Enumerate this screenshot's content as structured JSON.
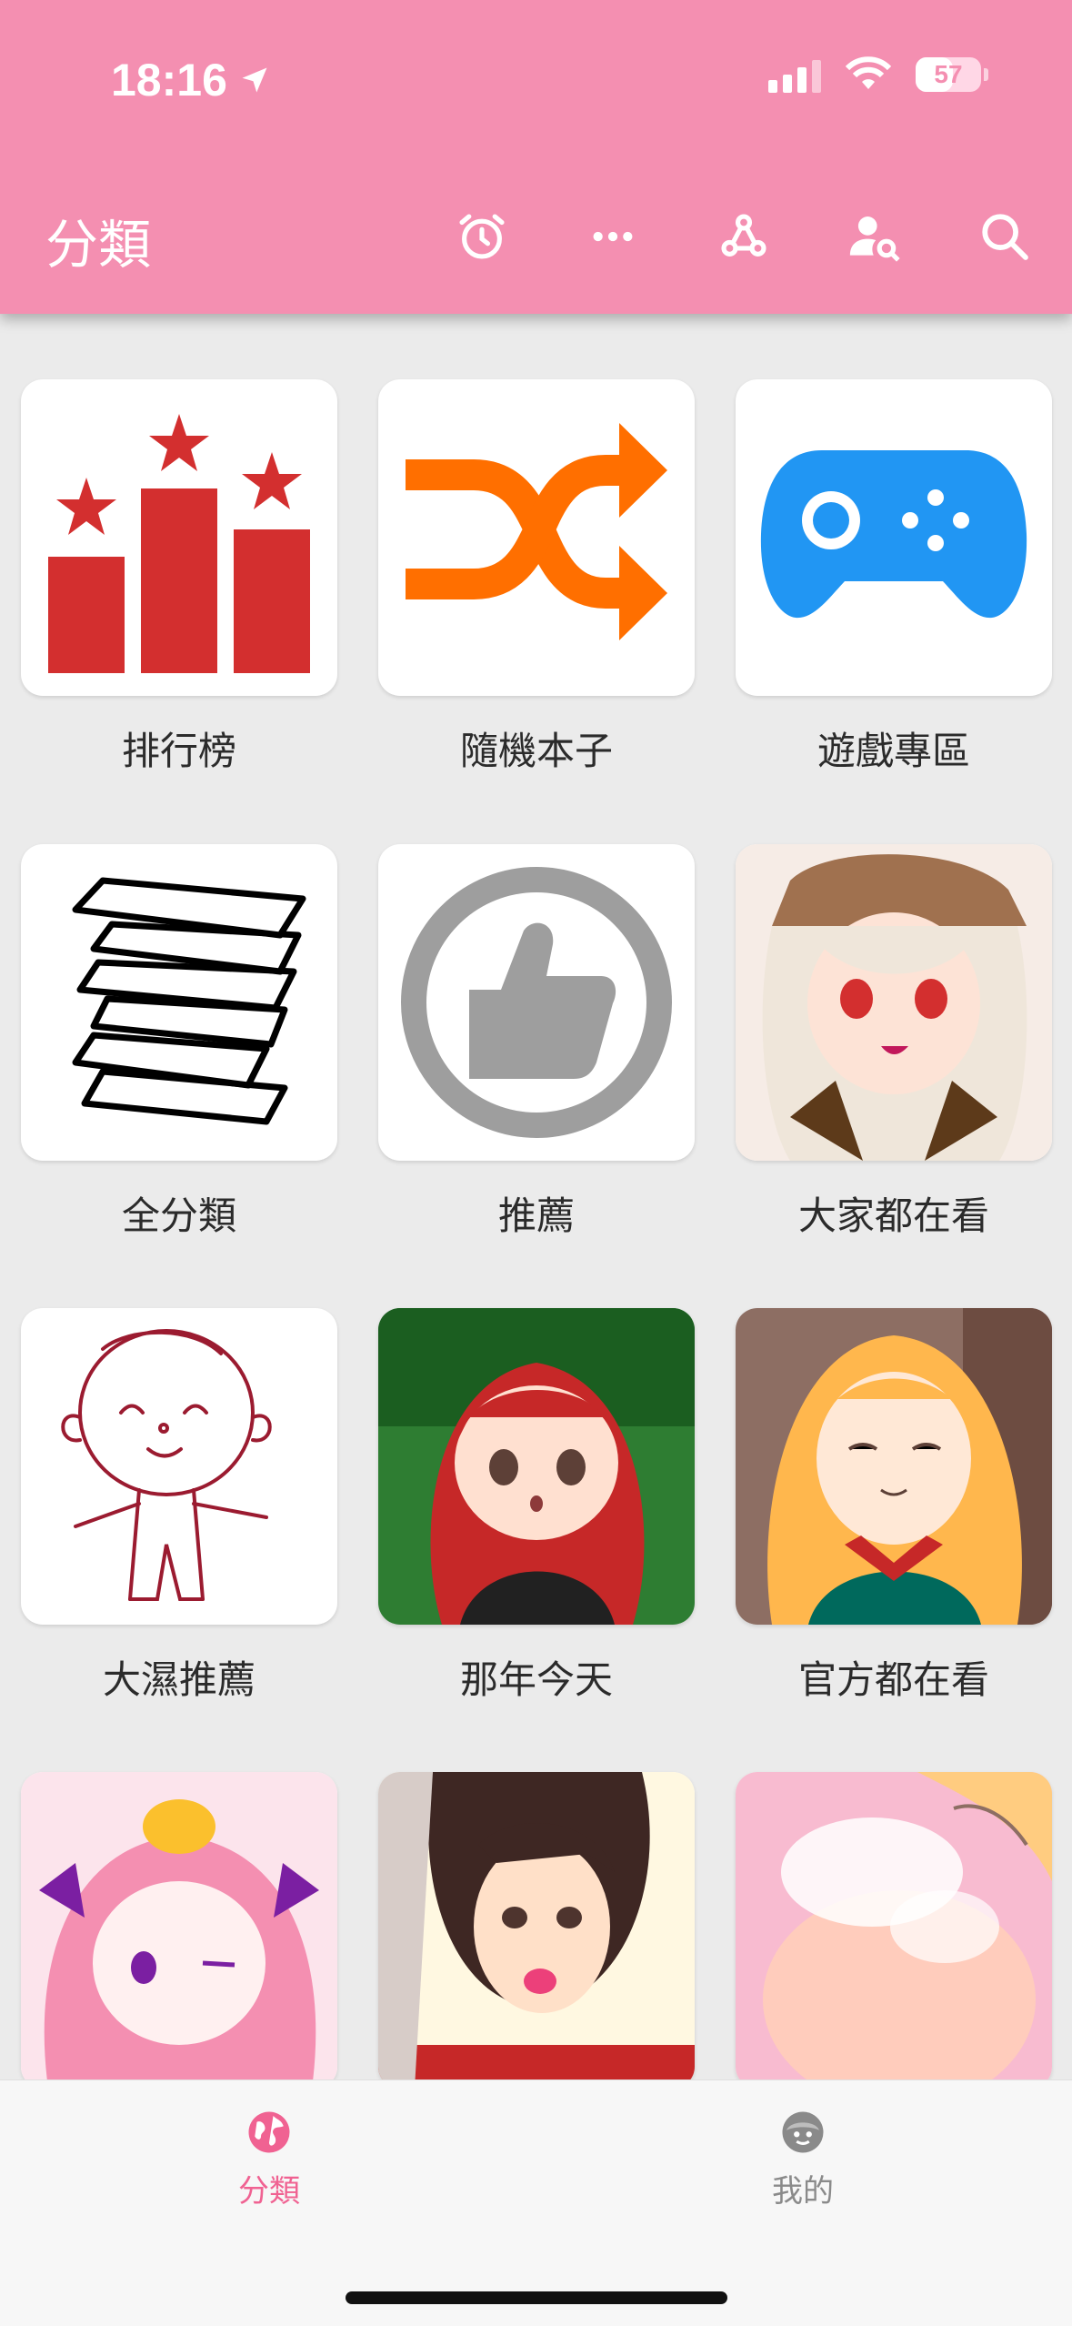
{
  "status": {
    "time": "18:16",
    "battery": "57"
  },
  "header": {
    "title": "分類",
    "accent": "#f48fb1"
  },
  "actions": [
    "alarm-icon",
    "more-horizontal-icon",
    "webhook-icon",
    "person-search-icon",
    "search-icon"
  ],
  "tiles": [
    {
      "label": "排行榜",
      "icon": "ranking-icon"
    },
    {
      "label": "隨機本子",
      "icon": "shuffle-icon"
    },
    {
      "label": "遊戲專區",
      "icon": "gamepad-icon"
    },
    {
      "label": "全分類",
      "icon": "books-icon"
    },
    {
      "label": "推薦",
      "icon": "thumbs-up-icon"
    },
    {
      "label": "大家都在看",
      "icon": "anime-thumbnail"
    },
    {
      "label": "大濕推薦",
      "icon": "sketch-figure-icon"
    },
    {
      "label": "那年今天",
      "icon": "anime-thumbnail"
    },
    {
      "label": "官方都在看",
      "icon": "anime-thumbnail"
    },
    {
      "label": "",
      "icon": "anime-thumbnail"
    },
    {
      "label": "",
      "icon": "anime-thumbnail"
    },
    {
      "label": "",
      "icon": "anime-thumbnail"
    }
  ],
  "nav": [
    {
      "label": "分類",
      "icon": "globe-icon",
      "active": true
    },
    {
      "label": "我的",
      "icon": "face-icon",
      "active": false
    }
  ]
}
